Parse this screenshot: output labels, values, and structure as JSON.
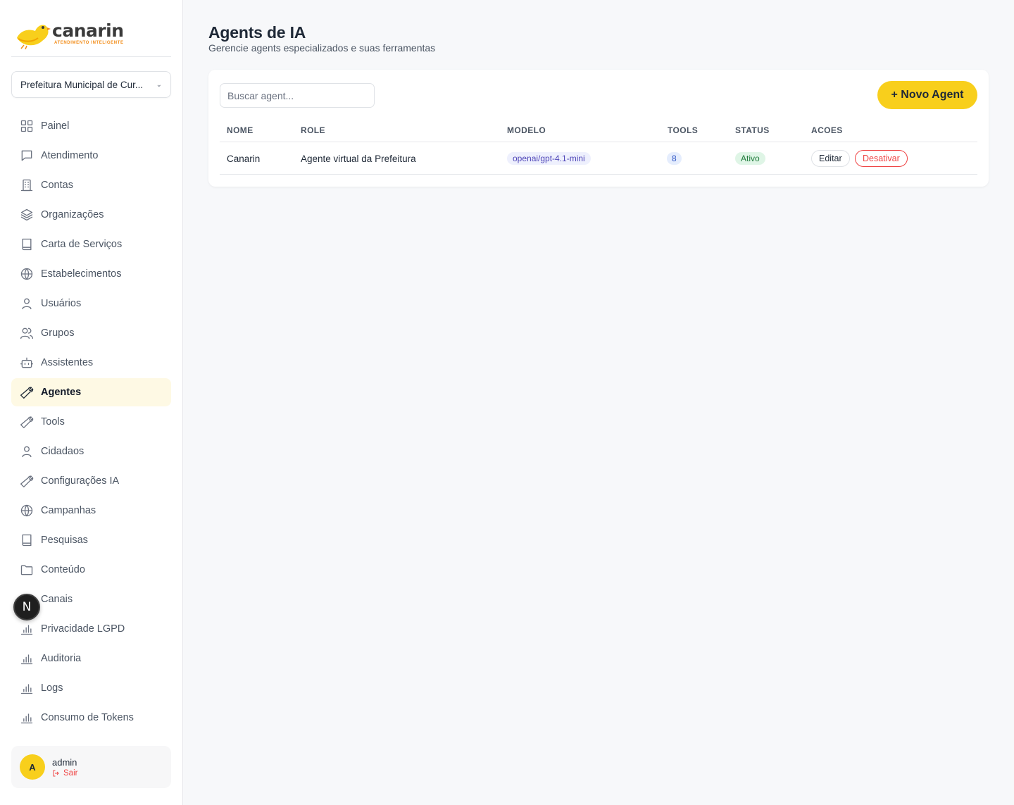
{
  "brand": {
    "name": "canarin",
    "tagline": "ATENDIMENTO INTELIGENTE",
    "color": "#f8cf1c"
  },
  "org_select": {
    "value": "Prefeitura Municipal de Curitiba",
    "display": "Prefeitura Municipal de Cur..."
  },
  "nav": [
    {
      "label": "Painel",
      "icon": "grid-icon"
    },
    {
      "label": "Atendimento",
      "icon": "chat-icon"
    },
    {
      "label": "Contas",
      "icon": "building-icon"
    },
    {
      "label": "Organizações",
      "icon": "layers-icon"
    },
    {
      "label": "Carta de Serviços",
      "icon": "book-icon"
    },
    {
      "label": "Estabelecimentos",
      "icon": "globe-icon"
    },
    {
      "label": "Usuários",
      "icon": "user-icon"
    },
    {
      "label": "Grupos",
      "icon": "users-icon"
    },
    {
      "label": "Assistentes",
      "icon": "bot-icon"
    },
    {
      "label": "Agentes",
      "icon": "wrench-icon",
      "active": true
    },
    {
      "label": "Tools",
      "icon": "wrench-icon"
    },
    {
      "label": "Cidadaos",
      "icon": "user-icon"
    },
    {
      "label": "Configurações IA",
      "icon": "wrench-icon"
    },
    {
      "label": "Campanhas",
      "icon": "globe-icon"
    },
    {
      "label": "Pesquisas",
      "icon": "book-icon"
    },
    {
      "label": "Conteúdo",
      "icon": "folder-icon"
    },
    {
      "label": "Canais",
      "icon": "bar-chart-icon"
    },
    {
      "label": "Privacidade LGPD",
      "icon": "bar-chart-icon"
    },
    {
      "label": "Auditoria",
      "icon": "bar-chart-icon"
    },
    {
      "label": "Logs",
      "icon": "bar-chart-icon"
    },
    {
      "label": "Consumo de Tokens",
      "icon": "bar-chart-icon"
    }
  ],
  "dev_badge": "N",
  "user": {
    "initial": "A",
    "name": "admin",
    "logout_label": "Sair"
  },
  "header": {
    "title": "Agents de IA",
    "subtitle": "Gerencie agents especializados e suas ferramentas"
  },
  "search": {
    "placeholder": "Buscar agent..."
  },
  "new_button": "+ Novo Agent",
  "table": {
    "columns": [
      "NOME",
      "ROLE",
      "MODELO",
      "TOOLS",
      "STATUS",
      "ACOES"
    ],
    "rows": [
      {
        "nome": "Canarin",
        "role": "Agente virtual da Prefeitura",
        "modelo": "openai/gpt-4.1-mini",
        "tools": "8",
        "status": "Ativo",
        "edit_label": "Editar",
        "deactivate_label": "Desativar"
      }
    ]
  }
}
